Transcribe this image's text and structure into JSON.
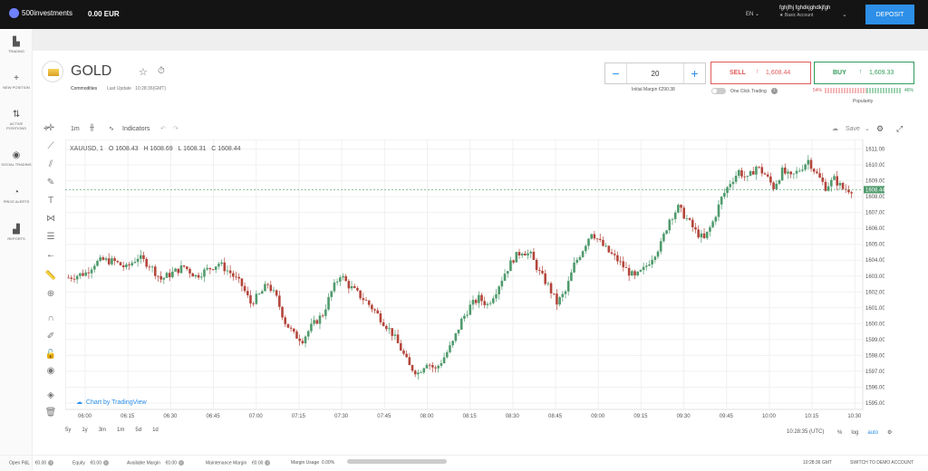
{
  "header": {
    "brand": "500investments",
    "balance": "0.00 EUR",
    "language": "EN",
    "user_name": "fghjfhj fghdkjghdkjfgh",
    "account_type": "★ Basic Account",
    "deposit_label": "DEPOSIT"
  },
  "sidebar": {
    "items": [
      {
        "label": "TRADING",
        "icon": "bar-chart-icon"
      },
      {
        "label": "NEW POSITION",
        "icon": "plus-icon"
      },
      {
        "label": "ACTIVE POSITIONS",
        "icon": "arrows-icon"
      },
      {
        "label": "SOCIAL TRADING",
        "icon": "globe-icon"
      },
      {
        "label": "PRICE ALERTS",
        "icon": "stopwatch-icon"
      },
      {
        "label": "REPORTS",
        "icon": "reports-icon"
      }
    ]
  },
  "instrument": {
    "name": "GOLD",
    "category": "Commodities",
    "last_update_label": "Last Update",
    "last_update_value": "10:28:36(GMT)"
  },
  "order": {
    "quantity": "20",
    "initial_margin": "Initial Margin €290.38",
    "sell_label": "SELL",
    "sell_price": "1,608.44",
    "buy_label": "BUY",
    "buy_price": "1,609.33",
    "one_click": "One Click Trading",
    "pop_sell": "54%",
    "pop_buy": "46%",
    "popularity": "Popularity",
    "buy_share": 0.46
  },
  "chart_toolbar": {
    "interval": "1m",
    "indicators": "Indicators",
    "save": "Save"
  },
  "legend": {
    "symbol": "XAUUSD, 1",
    "open": "O 1608.43",
    "high": "H 1608.69",
    "low": "L 1608.31",
    "close": "C 1608.44"
  },
  "credit": "Chart by TradingView",
  "ranges": [
    "5y",
    "1y",
    "3m",
    "1m",
    "5d",
    "1d"
  ],
  "time_utc": "10:28:35 (UTC)",
  "chart_opts": [
    "%",
    "log",
    "auto"
  ],
  "footer": {
    "open_pl": "Open P&L",
    "open_pl_v": "€0.00",
    "equity": "Equity",
    "equity_v": "€0.00",
    "avail": "Available Margin",
    "avail_v": "€0.00",
    "maint": "Maintenance Margin",
    "maint_v": "€0.00",
    "usage": "Margin Usage",
    "usage_v": "0.00%",
    "gmt": "10:28:36 GMT",
    "switch": "SWITCH TO DEMO ACCOUNT"
  },
  "colors": {
    "up": "#4f9a6c",
    "down": "#b4453b",
    "accent": "#2d8fe8"
  },
  "chart_data": {
    "type": "candlestick",
    "ylim": [
      1594.6,
      1611.6
    ],
    "yticks": [
      1595,
      1596,
      1597,
      1598,
      1599,
      1600,
      1601,
      1602,
      1603,
      1604,
      1605,
      1606,
      1607,
      1608,
      1609,
      1610,
      1611
    ],
    "ytick_labels": [
      "1595.00",
      "1596.00",
      "1597.00",
      "1598.00",
      "1599.00",
      "1600.00",
      "1601.00",
      "1602.00",
      "1603.00",
      "1604.00",
      "1605.00",
      "1606.00",
      "1607.00",
      "1608.00",
      "1609.00",
      "1610.00",
      "1611.00"
    ],
    "xtick_labels": [
      "06:00",
      "06:15",
      "06:30",
      "06:45",
      "07:00",
      "07:15",
      "07:30",
      "07:45",
      "08:00",
      "08:15",
      "08:30",
      "08:45",
      "09:00",
      "09:15",
      "09:30",
      "09:45",
      "10:00",
      "10:15",
      "10:30"
    ],
    "last_price": "1608.44",
    "close_path": [
      [
        0,
        1602.9
      ],
      [
        6,
        1603.2
      ],
      [
        9,
        1603.8
      ],
      [
        12,
        1604.0
      ],
      [
        16,
        1603.9
      ],
      [
        20,
        1603.5
      ],
      [
        24,
        1604.2
      ],
      [
        28,
        1603.7
      ],
      [
        32,
        1602.8
      ],
      [
        36,
        1603.2
      ],
      [
        40,
        1603.6
      ],
      [
        44,
        1603.0
      ],
      [
        48,
        1603.4
      ],
      [
        52,
        1603.8
      ],
      [
        56,
        1603.2
      ],
      [
        60,
        1602.4
      ],
      [
        63,
        1601.3
      ],
      [
        66,
        1601.8
      ],
      [
        69,
        1602.5
      ],
      [
        72,
        1601.6
      ],
      [
        75,
        1600.1
      ],
      [
        78,
        1599.3
      ],
      [
        81,
        1599.0
      ],
      [
        84,
        1599.8
      ],
      [
        88,
        1600.6
      ],
      [
        91,
        1602.0
      ],
      [
        94,
        1603.1
      ],
      [
        97,
        1602.4
      ],
      [
        100,
        1601.9
      ],
      [
        103,
        1601.4
      ],
      [
        106,
        1600.8
      ],
      [
        109,
        1600.1
      ],
      [
        112,
        1599.4
      ],
      [
        115,
        1598.4
      ],
      [
        118,
        1597.3
      ],
      [
        121,
        1596.9
      ],
      [
        124,
        1597.6
      ],
      [
        127,
        1597.1
      ],
      [
        130,
        1597.9
      ],
      [
        133,
        1598.8
      ],
      [
        136,
        1600.2
      ],
      [
        139,
        1601.1
      ],
      [
        142,
        1601.6
      ],
      [
        145,
        1601.2
      ],
      [
        148,
        1602.1
      ],
      [
        151,
        1603.2
      ],
      [
        154,
        1604.1
      ],
      [
        157,
        1604.6
      ],
      [
        160,
        1604.3
      ],
      [
        163,
        1603.2
      ],
      [
        166,
        1602.4
      ],
      [
        169,
        1601.3
      ],
      [
        172,
        1602.0
      ],
      [
        175,
        1603.7
      ],
      [
        178,
        1604.7
      ],
      [
        181,
        1605.8
      ],
      [
        184,
        1605.1
      ],
      [
        187,
        1604.5
      ],
      [
        190,
        1604.0
      ],
      [
        193,
        1603.4
      ],
      [
        196,
        1602.9
      ],
      [
        199,
        1603.4
      ],
      [
        202,
        1604.2
      ],
      [
        205,
        1605.0
      ],
      [
        208,
        1606.6
      ],
      [
        211,
        1607.3
      ],
      [
        214,
        1606.6
      ],
      [
        217,
        1605.8
      ],
      [
        220,
        1605.3
      ],
      [
        223,
        1606.4
      ],
      [
        226,
        1607.9
      ],
      [
        229,
        1608.9
      ],
      [
        232,
        1609.6
      ],
      [
        235,
        1609.1
      ],
      [
        238,
        1609.9
      ],
      [
        241,
        1609.4
      ],
      [
        244,
        1608.6
      ],
      [
        247,
        1609.6
      ],
      [
        250,
        1609.2
      ],
      [
        253,
        1609.7
      ],
      [
        256,
        1610.3
      ],
      [
        259,
        1609.4
      ],
      [
        262,
        1608.6
      ],
      [
        265,
        1609.1
      ],
      [
        268,
        1608.5
      ],
      [
        271,
        1608.44
      ]
    ]
  }
}
